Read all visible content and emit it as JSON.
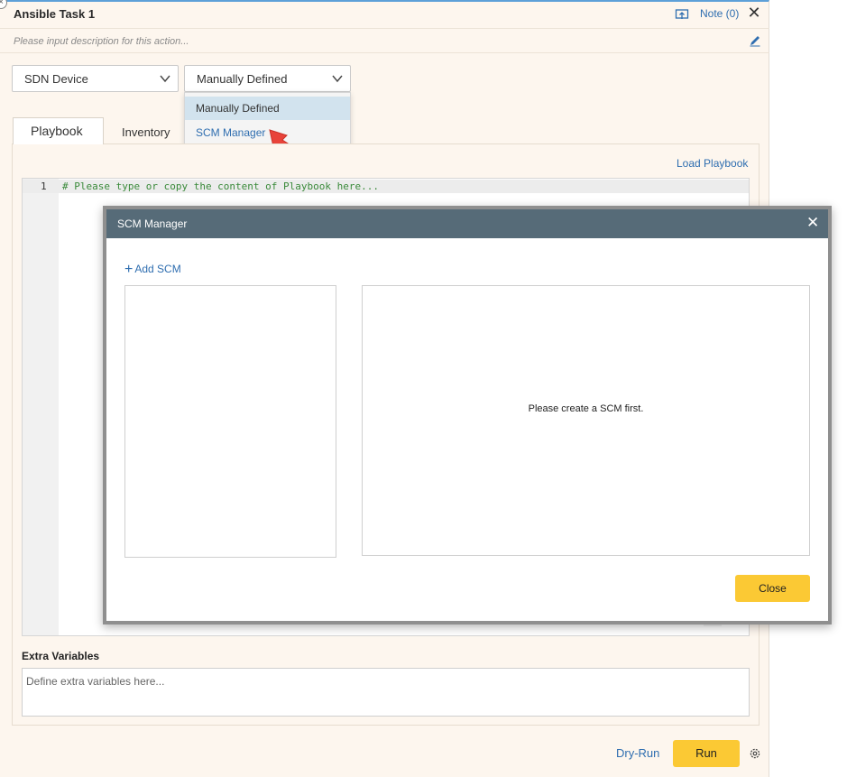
{
  "header": {
    "title": "Ansible Task 1",
    "note_label": "Note (0)",
    "close_glyph": "✕",
    "description_placeholder": "Please input description for this action..."
  },
  "selects": {
    "device": "SDN Device",
    "source": "Manually Defined"
  },
  "source_dropdown": {
    "options": [
      "Manually Defined",
      "SCM Manager"
    ],
    "highlighted": "Manually Defined",
    "hovered": "SCM Manager"
  },
  "tabs": [
    "Playbook",
    "Inventory"
  ],
  "active_tab": "Playbook",
  "load_playbook_label": "Load Playbook",
  "editor": {
    "line_number": "1",
    "placeholder": "# Please type or copy the content of Playbook here..."
  },
  "extra_variables": {
    "label": "Extra Variables",
    "placeholder": "Define extra variables here..."
  },
  "footer": {
    "dry_run_label": "Dry-Run",
    "run_label": "Run"
  },
  "modal": {
    "title": "SCM Manager",
    "close_glyph": "✕",
    "add_label": "Add SCM",
    "empty_message": "Please create a SCM first.",
    "close_button": "Close"
  },
  "colors": {
    "accent_yellow": "#fbc934",
    "link_blue": "#2f6eb0",
    "modal_header": "#566b78",
    "panel_bg": "#fdf6ee",
    "arrow_red": "#e8433a"
  }
}
